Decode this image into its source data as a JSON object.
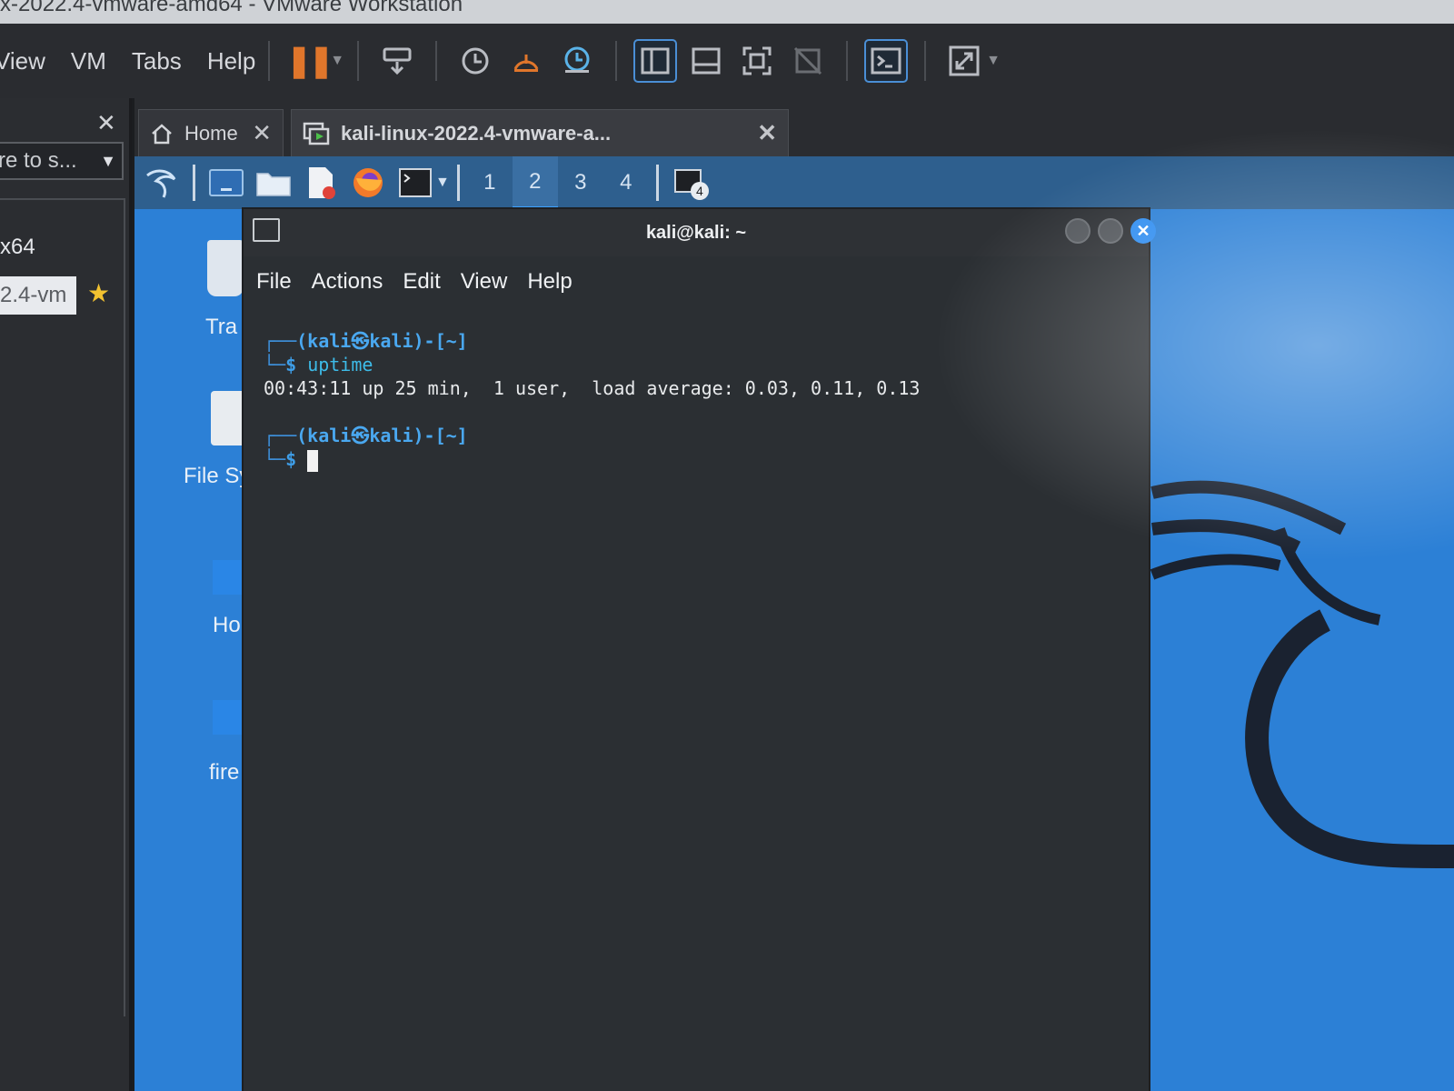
{
  "vmware": {
    "title": "x-2022.4-vmware-amd64 - VMware Workstation",
    "menu": [
      "View",
      "VM",
      "Tabs",
      "Help"
    ],
    "toolbar": {
      "pause_icon": "pause-icon",
      "items": [
        "send-keys-icon",
        "snapshot-icon",
        "revert-snapshot-icon",
        "snapshot-manager-icon",
        "library-view-icon",
        "thumbnail-view-icon",
        "full-screen-icon",
        "unity-icon",
        "console-view-icon",
        "stretch-icon"
      ]
    },
    "sidebar": {
      "search_text": "re to s...",
      "items": [
        "x64",
        "2.4-vm"
      ]
    },
    "tabs": [
      {
        "label": "Home"
      },
      {
        "label": "kali-linux-2022.4-vmware-a..."
      }
    ]
  },
  "guest": {
    "panel": {
      "workspaces": [
        "1",
        "2",
        "3",
        "4"
      ],
      "current_workspace": "2",
      "tasks_badge": "4"
    },
    "desktop_icons": [
      "Tra",
      "File Sy",
      "Ho",
      "fire"
    ],
    "terminal": {
      "title": "kali@kali: ~",
      "menu": [
        "File",
        "Actions",
        "Edit",
        "View",
        "Help"
      ],
      "lines": {
        "p1_user": "(kali㉿kali)-[~]",
        "p1_cmd": "uptime",
        "output": "00:43:11 up 25 min,  1 user,  load average: 0.03, 0.11, 0.13",
        "p2_user": "(kali㉿kali)-[~]"
      }
    },
    "colors": {
      "desktop_blue": "#2c80d6",
      "prompt_blue": "#3e9ee8",
      "close_button": "#2f8df0"
    }
  }
}
